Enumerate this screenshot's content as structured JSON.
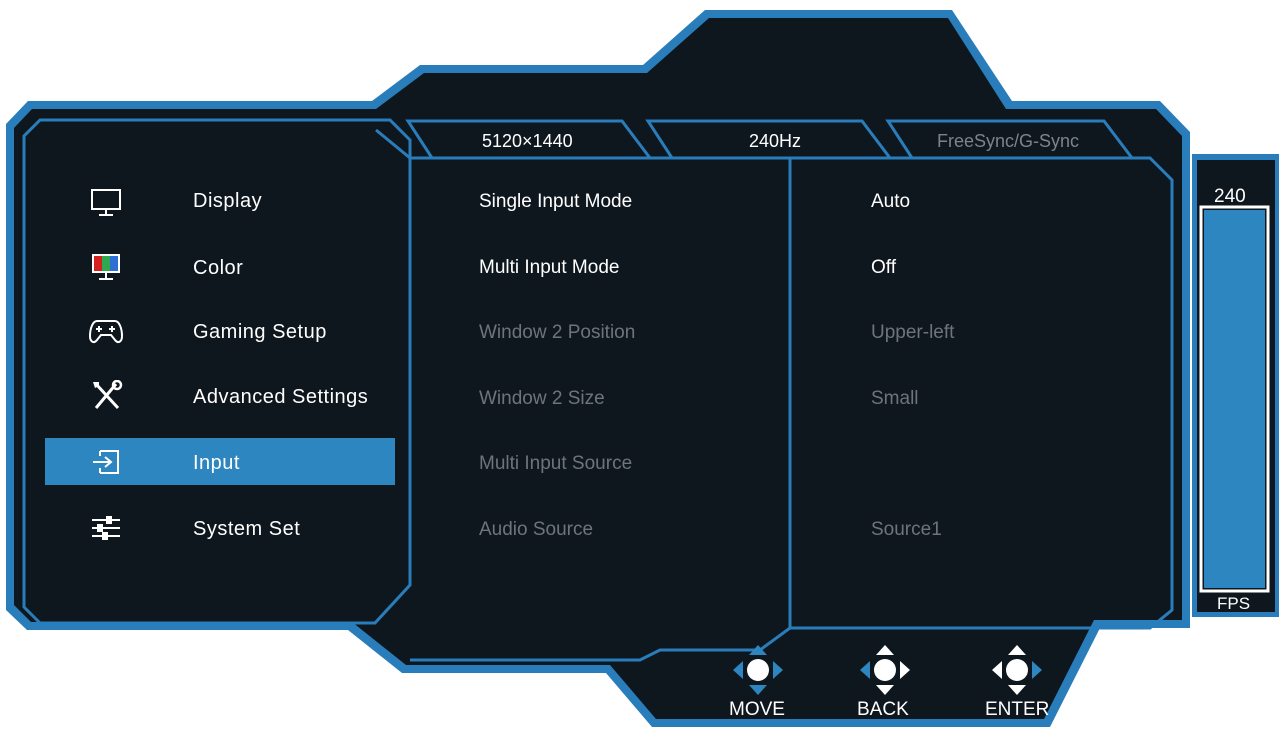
{
  "colors": {
    "accent": "#2e86c1",
    "frame_outer": "#2a7dbb",
    "panel_bg": "#0f171e",
    "text": "#ffffff",
    "text_dim": "#6e747a"
  },
  "tabs": [
    {
      "label": "5120×1440",
      "active": true
    },
    {
      "label": "240Hz",
      "active": true
    },
    {
      "label": "FreeSync/G-Sync",
      "active": false
    }
  ],
  "menu": {
    "items": [
      {
        "label": "Display",
        "icon": "monitor-icon",
        "active": false
      },
      {
        "label": "Color",
        "icon": "color-bars-icon",
        "active": false
      },
      {
        "label": "Gaming Setup",
        "icon": "gamepad-icon",
        "active": false
      },
      {
        "label": "Advanced Settings",
        "icon": "wrench-screwdriver-icon",
        "active": false
      },
      {
        "label": "Input",
        "icon": "input-arrow-icon",
        "active": true
      },
      {
        "label": "System Set",
        "icon": "sliders-icon",
        "active": false
      }
    ]
  },
  "options": [
    {
      "label": "Single Input Mode",
      "value": "Auto",
      "enabled": true
    },
    {
      "label": "Multi Input Mode",
      "value": "Off",
      "enabled": true
    },
    {
      "label": "Window 2 Position",
      "value": "Upper-left",
      "enabled": false
    },
    {
      "label": "Window 2 Size",
      "value": "Small",
      "enabled": false
    },
    {
      "label": "Multi Input Source",
      "value": "",
      "enabled": false
    },
    {
      "label": "Audio Source",
      "value": "Source1",
      "enabled": false
    }
  ],
  "fps": {
    "value": "240",
    "unit": "FPS",
    "level": 1.0
  },
  "nav": [
    {
      "label": "MOVE",
      "icon": "joystick-move-icon"
    },
    {
      "label": "BACK",
      "icon": "joystick-back-icon"
    },
    {
      "label": "ENTER",
      "icon": "joystick-enter-icon"
    }
  ]
}
